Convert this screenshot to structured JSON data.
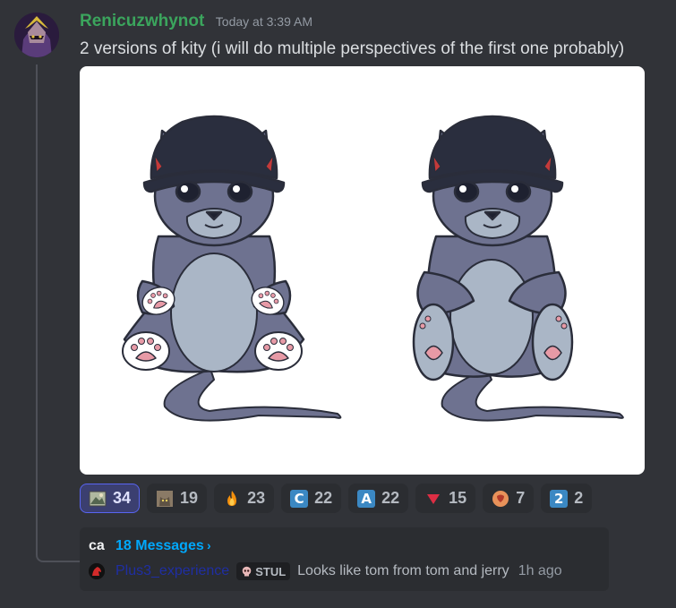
{
  "message": {
    "username": "Renicuzwhynot",
    "timestamp": "Today at 3:39 AM",
    "text": "2 versions of kity (i will do multiple perspectives of the first one probably)"
  },
  "reactions": [
    {
      "icon": "picture-emoji",
      "count": "34",
      "active": true
    },
    {
      "icon": "cat-photo-emoji",
      "count": "19",
      "active": false
    },
    {
      "icon": "fire-emoji",
      "count": "23",
      "active": false
    },
    {
      "icon": "letter-c-emoji",
      "letter": "C",
      "count": "22",
      "active": false
    },
    {
      "icon": "letter-a-emoji",
      "letter": "A",
      "count": "22",
      "active": false
    },
    {
      "icon": "red-triangle-emoji",
      "count": "15",
      "active": false
    },
    {
      "icon": "heart-face-emoji",
      "count": "7",
      "active": false
    },
    {
      "icon": "keycap-2-emoji",
      "letter": "2",
      "count": "2",
      "active": false
    }
  ],
  "thread": {
    "name": "ca",
    "count": "18 Messages",
    "chevron": "›",
    "reply_author": "Plus3_experience",
    "tag": "STUL",
    "reply_text": "Looks like tom from tom and jerry",
    "reply_time": "1h ago"
  },
  "colors": {
    "background": "#313338",
    "username": "#3ba55d",
    "link": "#00a8fc",
    "active_reaction_border": "#5865f2"
  }
}
